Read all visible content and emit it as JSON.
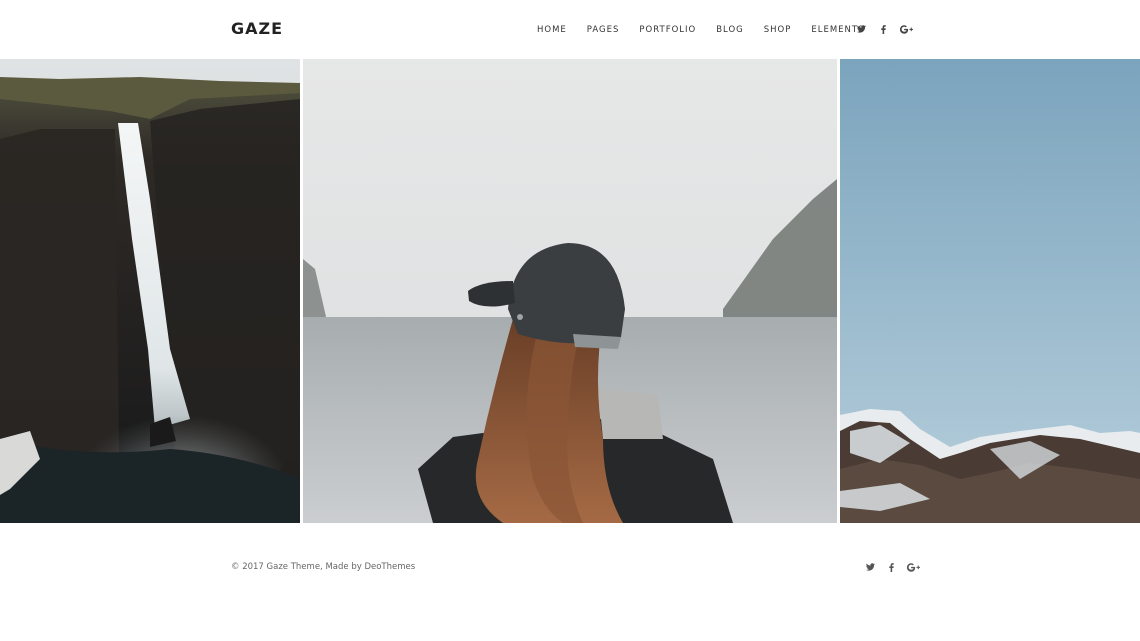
{
  "site": {
    "logo": "GAZE"
  },
  "nav": {
    "items": [
      "HOME",
      "PAGES",
      "PORTFOLIO",
      "BLOG",
      "SHOP",
      "ELEMENTS"
    ]
  },
  "social": {
    "icons": [
      "twitter-icon",
      "facebook-icon",
      "google-plus-icon"
    ],
    "google_plus_label": "G+"
  },
  "gallery": {
    "images": [
      "waterfall",
      "woman-in-cap-by-lake",
      "snowy-mountains"
    ]
  },
  "footer": {
    "copyright": "© 2017 Gaze Theme, Made by DeoThemes"
  },
  "colors": {
    "text": "#222222",
    "muted": "#666666",
    "sky": "#86aec4"
  }
}
